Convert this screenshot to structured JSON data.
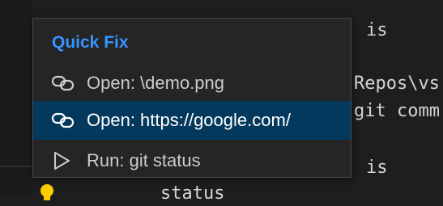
{
  "editor": {
    "lines": [
      {
        "text": "is"
      },
      {
        "text": "Repos\\vs"
      },
      {
        "text": "git comm"
      },
      {
        "text": "is"
      },
      {
        "text": "status"
      }
    ]
  },
  "quick_fix": {
    "title": "Quick Fix",
    "items": [
      {
        "label": "Open: \\demo.png",
        "icon": "link-icon",
        "selected": false
      },
      {
        "label": "Open: https://google.com/",
        "icon": "link-icon",
        "selected": true
      },
      {
        "label": "Run: git status",
        "icon": "play-icon",
        "selected": false
      }
    ]
  },
  "colors": {
    "accent": "#3794ff",
    "selection": "#04395e",
    "lightbulb": "#ffcc00"
  }
}
